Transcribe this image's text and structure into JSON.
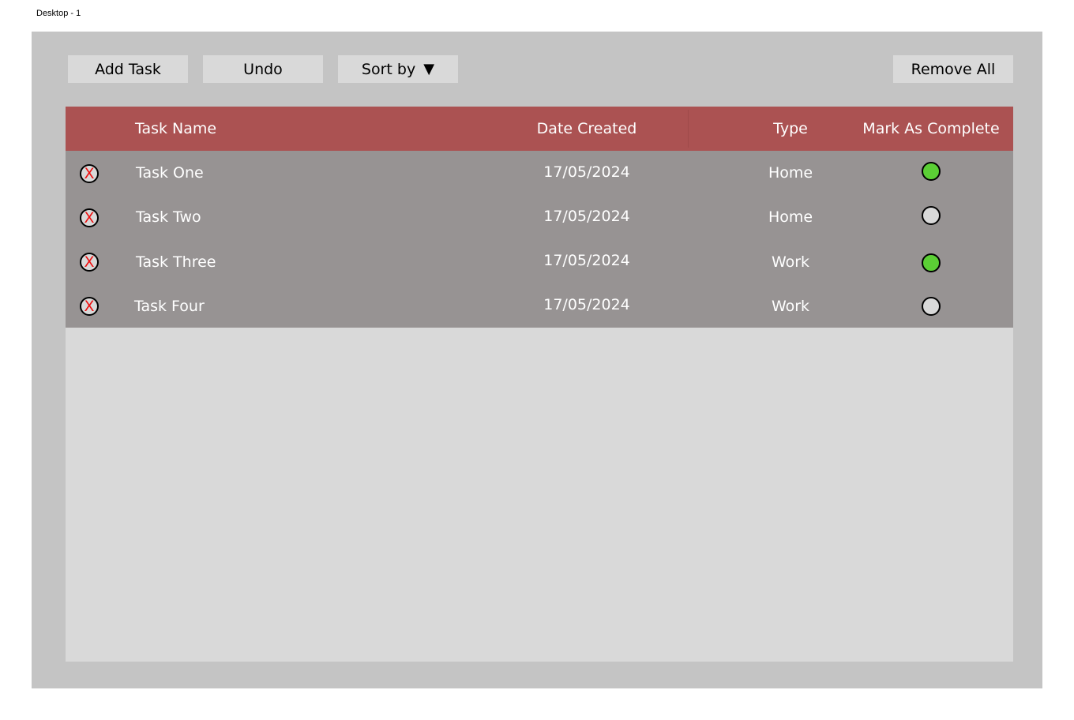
{
  "frame": {
    "label": "Desktop - 1"
  },
  "toolbar": {
    "add_label": "Add Task",
    "undo_label": "Undo",
    "sort_label": "Sort by",
    "sort_caret": "▼",
    "remove_all_label": "Remove All"
  },
  "table": {
    "headers": {
      "name": "Task Name",
      "date": "Date Created",
      "type": "Type",
      "complete": "Mark As Complete"
    },
    "delete_glyph": "X",
    "rows": [
      {
        "name": "Task One",
        "date": "17/05/2024",
        "type": "Home",
        "complete": true
      },
      {
        "name": "Task Two",
        "date": "17/05/2024",
        "type": "Home",
        "complete": false
      },
      {
        "name": "Task Three",
        "date": "17/05/2024",
        "type": "Work",
        "complete": true
      },
      {
        "name": "Task Four",
        "date": "17/05/2024",
        "type": "Work",
        "complete": false
      }
    ]
  },
  "colors": {
    "header_bg": "#ab5252",
    "row_bg": "#979393",
    "complete_on": "#5bcf35",
    "complete_off": "#d9d9d9",
    "delete_x": "#ee1111"
  },
  "icons": {
    "delete": "delete-circle-x-icon",
    "complete": "status-circle-icon",
    "sort": "caret-down-icon"
  }
}
